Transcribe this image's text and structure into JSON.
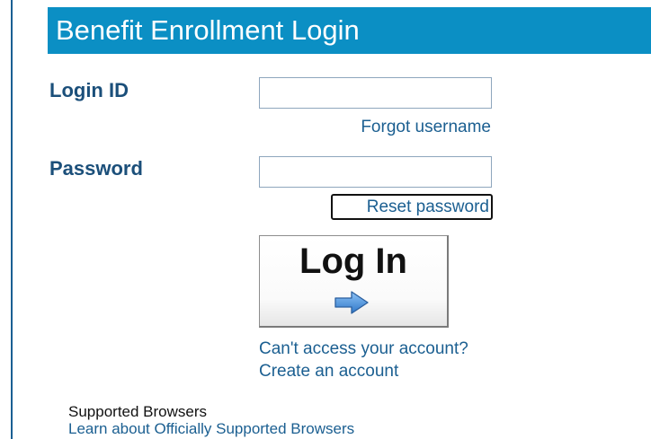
{
  "header": {
    "title": "Benefit Enrollment Login"
  },
  "form": {
    "login_id_label": "Login ID",
    "login_id_value": "",
    "forgot_username_link": "Forgot username",
    "password_label": "Password",
    "password_value": "",
    "reset_password_link": "Reset password",
    "login_button_label": "Log In",
    "login_button_icon": "arrow-right-icon"
  },
  "links": {
    "cant_access": "Can't access your account?",
    "create_account": "Create an account"
  },
  "browsers": {
    "heading": "Supported Browsers",
    "learn_link": "Learn about Officially Supported Browsers"
  },
  "colors": {
    "header_background": "#0b8fc4",
    "label_text": "#1b4f7a",
    "link_text": "#1b5f91",
    "arrow": "#4a8fd8"
  }
}
